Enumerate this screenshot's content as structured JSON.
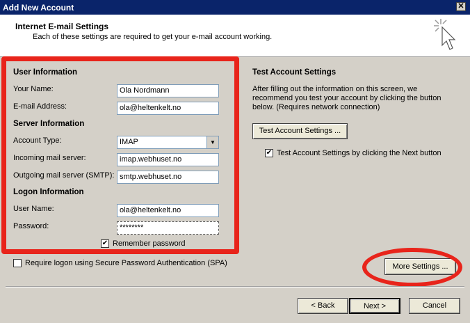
{
  "window": {
    "title": "Add New Account"
  },
  "header": {
    "title": "Internet E-mail Settings",
    "subtitle": "Each of these settings are required to get your e-mail account working."
  },
  "user_info": {
    "heading": "User Information",
    "name_label": "Your Name:",
    "name_value": "Ola Nordmann",
    "email_label": "E-mail Address:",
    "email_value": "ola@heltenkelt.no"
  },
  "server_info": {
    "heading": "Server Information",
    "account_type_label": "Account Type:",
    "account_type_value": "IMAP",
    "incoming_label": "Incoming mail server:",
    "incoming_value": "imap.webhuset.no",
    "outgoing_label": "Outgoing mail server (SMTP):",
    "outgoing_value": "smtp.webhuset.no"
  },
  "logon_info": {
    "heading": "Logon Information",
    "username_label": "User Name:",
    "username_value": "ola@heltenkelt.no",
    "password_label": "Password:",
    "password_value": "********",
    "remember_label": "Remember password"
  },
  "spa": {
    "label": "Require logon using Secure Password Authentication (SPA)"
  },
  "test": {
    "heading": "Test Account Settings",
    "description": "After filling out the information on this screen, we recommend you test your account by clicking the button below. (Requires network connection)",
    "button": "Test Account Settings ...",
    "next_check_label": "Test Account Settings by clicking the Next button"
  },
  "more_settings": {
    "button": "More Settings ..."
  },
  "footer": {
    "back": "< Back",
    "next": "Next >",
    "cancel": "Cancel"
  },
  "colors": {
    "title_bar": "#0a246a",
    "annotation": "#e8241b",
    "dialog_bg": "#d4d0c8"
  }
}
